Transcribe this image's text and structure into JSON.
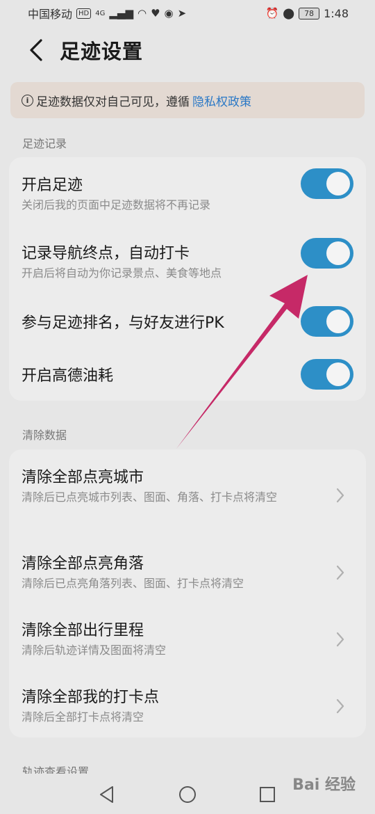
{
  "status_bar": {
    "carrier": "中国移动",
    "hd": "HD",
    "network": "4G",
    "battery": "78",
    "time": "1:48"
  },
  "header": {
    "title": "足迹设置"
  },
  "notice": {
    "text": "足迹数据仅对自己可见，遵循",
    "link": "隐私权政策"
  },
  "footprint_section": {
    "title": "足迹记录",
    "items": [
      {
        "title": "开启足迹",
        "subtitle": "关闭后我的页面中足迹数据将不再记录",
        "on": true
      },
      {
        "title": "记录导航终点，自动打卡",
        "subtitle": "开启后将自动为你记录景点、美食等地点",
        "on": true
      },
      {
        "title": "参与足迹排名，与好友进行PK",
        "subtitle": "",
        "on": true
      },
      {
        "title": "开启高德油耗",
        "subtitle": "",
        "on": true
      }
    ]
  },
  "clear_section": {
    "title": "清除数据",
    "items": [
      {
        "title": "清除全部点亮城市",
        "subtitle": "清除后已点亮城市列表、图面、角落、打卡点将清空"
      },
      {
        "title": "清除全部点亮角落",
        "subtitle": "清除后已点亮角落列表、图面、打卡点将清空"
      },
      {
        "title": "清除全部出行里程",
        "subtitle": "清除后轨迹详情及图面将清空"
      },
      {
        "title": "清除全部我的打卡点",
        "subtitle": "清除后全部打卡点将清空"
      }
    ]
  },
  "track_section": {
    "title": "轨迹查看设置"
  },
  "watermark": "Bai 经验",
  "colors": {
    "toggle_on": "#2d8fc7",
    "link": "#2a78c6",
    "arrow": "#c2185b"
  }
}
